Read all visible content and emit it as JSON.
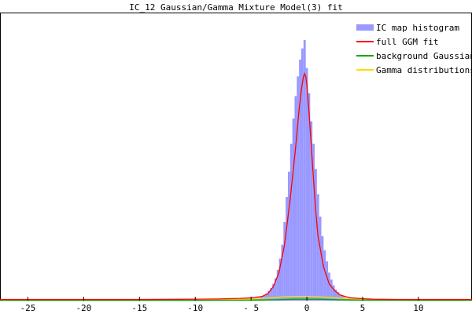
{
  "chart_data": {
    "type": "bar",
    "title": "IC_12 Gaussian/Gamma Mixture Model(3) fit",
    "xlabel": "",
    "ylabel": "",
    "xlim": [
      -27.5,
      14.8
    ],
    "ylim": [
      0,
      1.0
    ],
    "grid": false,
    "legend_position": "top-right",
    "x_ticks": [
      -25,
      -20,
      -15,
      -10,
      -5,
      0,
      5,
      10
    ],
    "x_tick_labels": [
      "-25",
      "-20",
      "-15",
      "-10",
      "- 5",
      "0",
      "5",
      "10"
    ],
    "bin_width": 0.2,
    "series": [
      {
        "name": "IC map histogram",
        "kind": "histogram",
        "color": "#9999ff",
        "x": [
          -4.8,
          -4.6,
          -4.4,
          -4.2,
          -4.0,
          -3.8,
          -3.6,
          -3.4,
          -3.2,
          -3.0,
          -2.8,
          -2.6,
          -2.4,
          -2.2,
          -2.0,
          -1.8,
          -1.6,
          -1.4,
          -1.2,
          -1.0,
          -0.8,
          -0.6,
          -0.4,
          -0.2,
          0.0,
          0.2,
          0.4,
          0.6,
          0.8,
          1.0,
          1.2,
          1.4,
          1.6,
          1.8,
          2.0,
          2.2,
          2.4,
          2.6,
          2.8,
          3.0,
          3.2,
          3.4,
          3.6,
          3.8,
          4.0,
          4.2,
          4.4,
          4.6,
          4.8
        ],
        "values": [
          0.006,
          0.008,
          0.01,
          0.012,
          0.016,
          0.02,
          0.026,
          0.035,
          0.045,
          0.06,
          0.08,
          0.11,
          0.15,
          0.2,
          0.28,
          0.37,
          0.46,
          0.56,
          0.65,
          0.73,
          0.8,
          0.86,
          0.9,
          0.93,
          0.83,
          0.74,
          0.64,
          0.56,
          0.47,
          0.38,
          0.3,
          0.23,
          0.18,
          0.14,
          0.1,
          0.075,
          0.055,
          0.04,
          0.03,
          0.022,
          0.016,
          0.012,
          0.009,
          0.007,
          0.006,
          0.005,
          0.004,
          0.004,
          0.003
        ]
      },
      {
        "name": "full GGM fit",
        "kind": "line",
        "color": "#ff0000",
        "x": [
          -27.5,
          -20,
          -15,
          -10,
          -8,
          -6,
          -5,
          -4,
          -3.5,
          -3,
          -2.5,
          -2,
          -1.5,
          -1,
          -0.7,
          -0.5,
          -0.3,
          -0.2,
          -0.1,
          0,
          0.2,
          0.4,
          0.6,
          0.8,
          1,
          1.5,
          2,
          2.5,
          3,
          3.5,
          4,
          5,
          6,
          8,
          10,
          14.8
        ],
        "values": [
          0.004,
          0.004,
          0.004,
          0.005,
          0.006,
          0.008,
          0.01,
          0.015,
          0.025,
          0.05,
          0.1,
          0.2,
          0.36,
          0.55,
          0.68,
          0.75,
          0.8,
          0.81,
          0.8,
          0.77,
          0.67,
          0.55,
          0.43,
          0.32,
          0.23,
          0.12,
          0.06,
          0.035,
          0.02,
          0.014,
          0.01,
          0.007,
          0.005,
          0.004,
          0.004,
          0.004
        ]
      },
      {
        "name": "background Gaussian",
        "kind": "line",
        "color": "#00aa00",
        "x": [
          -27.5,
          -10,
          -5,
          -3,
          -2,
          -1,
          0,
          1,
          2,
          3,
          5,
          10,
          14.8
        ],
        "values": [
          0.001,
          0.001,
          0.002,
          0.003,
          0.004,
          0.005,
          0.005,
          0.005,
          0.004,
          0.003,
          0.002,
          0.001,
          0.001
        ]
      },
      {
        "name": "Gamma distributions",
        "kind": "line",
        "color": "#ffdd00",
        "x": [
          -27.5,
          -10,
          -6,
          -4,
          -3,
          -2,
          -1,
          0,
          1,
          2,
          3,
          4,
          6,
          10,
          14.8
        ],
        "values": [
          0.002,
          0.003,
          0.005,
          0.008,
          0.011,
          0.014,
          0.015,
          0.015,
          0.014,
          0.012,
          0.009,
          0.007,
          0.004,
          0.003,
          0.002
        ]
      }
    ]
  }
}
